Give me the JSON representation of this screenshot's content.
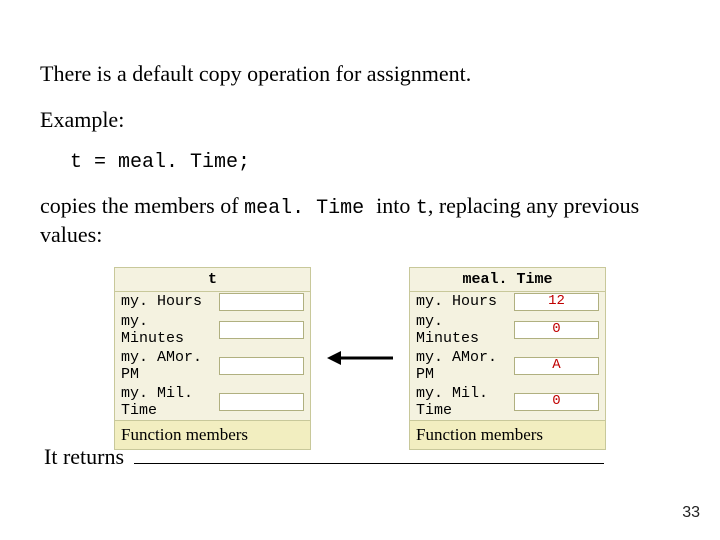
{
  "text": {
    "intro": "There is a default copy operation for assignment.",
    "example_label": "Example:",
    "code": "t = meal. Time;",
    "copies_pre": "copies the members of ",
    "copies_obj": "meal. Time ",
    "copies_mid": "into ",
    "copies_var": "t",
    "copies_post": ", replacing any previous values:",
    "returns_label": "It returns"
  },
  "objects": {
    "left": {
      "title": "t",
      "members": [
        {
          "name": "my. Hours",
          "value": ""
        },
        {
          "name": "my. Minutes",
          "value": ""
        },
        {
          "name": "my. AMor. PM",
          "value": ""
        },
        {
          "name": "my. Mil. Time",
          "value": ""
        }
      ],
      "footer": "Function members"
    },
    "right": {
      "title": "meal. Time",
      "members": [
        {
          "name": "my. Hours",
          "value": "12"
        },
        {
          "name": "my. Minutes",
          "value": "0"
        },
        {
          "name": "my. AMor. PM",
          "value": "A"
        },
        {
          "name": "my. Mil. Time",
          "value": "0"
        }
      ],
      "footer": "Function members"
    }
  },
  "page_number": "33"
}
